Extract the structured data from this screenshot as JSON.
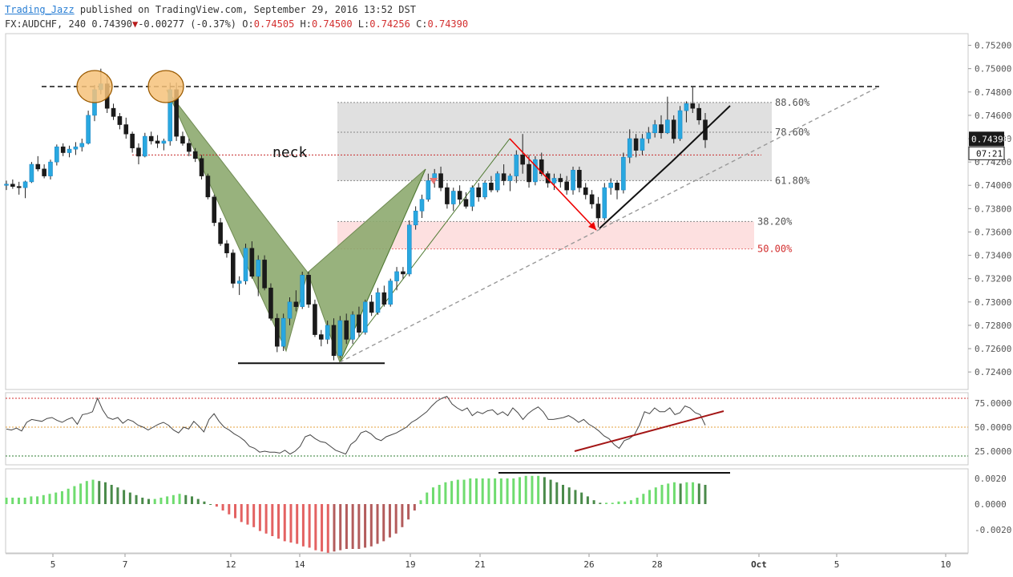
{
  "header": {
    "author": "Trading_Jazz",
    "published_text": " published on TradingView.com, September 29, 2016 13:52 DST",
    "symbol": "FX:AUDCHF, 240",
    "last": "0.74390",
    "change": "-0.00277 (-0.37%)",
    "open_label": "O:",
    "open": "0.74505",
    "high_label": "H:",
    "high": "0.74500",
    "low_label": "L:",
    "low": "0.74256",
    "close_label": "C:",
    "close": "0.74390"
  },
  "chart_data": {
    "type": "candlestick",
    "price_axis": {
      "ylim": [
        0.7225,
        0.753
      ],
      "ticks": [
        "0.75200",
        "0.75000",
        "0.74800",
        "0.74600",
        "0.74400",
        "0.74200",
        "0.74000",
        "0.73800",
        "0.73600",
        "0.73400",
        "0.73200",
        "0.73000",
        "0.72800",
        "0.72600",
        "0.72400"
      ]
    },
    "last_price_label": "0.74398",
    "countdown_label": "07:21",
    "x_ticks": [
      "5",
      "7",
      "12",
      "14",
      "19",
      "21",
      "26",
      "28",
      "Oct",
      "5",
      "10"
    ],
    "candles": [
      [
        0.74,
        0.7404,
        0.7396,
        0.7401
      ],
      [
        0.7401,
        0.7405,
        0.7397,
        0.7399
      ],
      [
        0.7399,
        0.7403,
        0.7392,
        0.7398
      ],
      [
        0.7398,
        0.7404,
        0.7389,
        0.7403
      ],
      [
        0.7403,
        0.742,
        0.7402,
        0.7418
      ],
      [
        0.7418,
        0.7425,
        0.7412,
        0.7414
      ],
      [
        0.7414,
        0.7418,
        0.7406,
        0.7408
      ],
      [
        0.7408,
        0.7422,
        0.7405,
        0.742
      ],
      [
        0.742,
        0.7435,
        0.7417,
        0.7433
      ],
      [
        0.7433,
        0.7436,
        0.7425,
        0.7428
      ],
      [
        0.7428,
        0.7434,
        0.7424,
        0.7431
      ],
      [
        0.7431,
        0.7437,
        0.7426,
        0.7433
      ],
      [
        0.7433,
        0.744,
        0.7429,
        0.7436
      ],
      [
        0.7436,
        0.7464,
        0.7435,
        0.746
      ],
      [
        0.746,
        0.7486,
        0.7455,
        0.7482
      ],
      [
        0.7482,
        0.75,
        0.7478,
        0.7487
      ],
      [
        0.7487,
        0.7495,
        0.7462,
        0.7466
      ],
      [
        0.7466,
        0.747,
        0.7456,
        0.7459
      ],
      [
        0.7459,
        0.7462,
        0.7448,
        0.7452
      ],
      [
        0.7452,
        0.7458,
        0.744,
        0.7444
      ],
      [
        0.7444,
        0.7446,
        0.7428,
        0.7432
      ],
      [
        0.7432,
        0.7436,
        0.7418,
        0.7425
      ],
      [
        0.7425,
        0.7445,
        0.7424,
        0.7442
      ],
      [
        0.7442,
        0.7446,
        0.7435,
        0.7438
      ],
      [
        0.7438,
        0.7443,
        0.7432,
        0.7436
      ],
      [
        0.7436,
        0.744,
        0.743,
        0.7438
      ],
      [
        0.7438,
        0.7488,
        0.7434,
        0.7482
      ],
      [
        0.7482,
        0.7488,
        0.7438,
        0.7442
      ],
      [
        0.7442,
        0.7446,
        0.7434,
        0.7436
      ],
      [
        0.7436,
        0.744,
        0.7425,
        0.7429
      ],
      [
        0.7429,
        0.7432,
        0.742,
        0.7423
      ],
      [
        0.7423,
        0.7426,
        0.7405,
        0.7408
      ],
      [
        0.7408,
        0.741,
        0.7388,
        0.739
      ],
      [
        0.739,
        0.7392,
        0.7365,
        0.7368
      ],
      [
        0.7368,
        0.7372,
        0.7348,
        0.735
      ],
      [
        0.735,
        0.7353,
        0.7338,
        0.7342
      ],
      [
        0.7342,
        0.7345,
        0.7312,
        0.7316
      ],
      [
        0.7316,
        0.7322,
        0.7306,
        0.7318
      ],
      [
        0.7318,
        0.735,
        0.7315,
        0.7346
      ],
      [
        0.7346,
        0.7352,
        0.732,
        0.7322
      ],
      [
        0.7322,
        0.734,
        0.7305,
        0.7336
      ],
      [
        0.7336,
        0.734,
        0.731,
        0.7312
      ],
      [
        0.7312,
        0.7316,
        0.7284,
        0.7286
      ],
      [
        0.7286,
        0.729,
        0.7257,
        0.7262
      ],
      [
        0.7262,
        0.729,
        0.7258,
        0.7286
      ],
      [
        0.7286,
        0.7304,
        0.728,
        0.73
      ],
      [
        0.73,
        0.731,
        0.7292,
        0.7296
      ],
      [
        0.7296,
        0.7326,
        0.7294,
        0.7323
      ],
      [
        0.7323,
        0.7326,
        0.7295,
        0.7298
      ],
      [
        0.7298,
        0.7302,
        0.727,
        0.7272
      ],
      [
        0.7272,
        0.7276,
        0.7262,
        0.7268
      ],
      [
        0.7268,
        0.7284,
        0.7264,
        0.728
      ],
      [
        0.728,
        0.7286,
        0.725,
        0.7254
      ],
      [
        0.7254,
        0.7288,
        0.7252,
        0.7284
      ],
      [
        0.7284,
        0.729,
        0.7264,
        0.7268
      ],
      [
        0.7268,
        0.7292,
        0.7264,
        0.7289
      ],
      [
        0.7289,
        0.7296,
        0.727,
        0.7274
      ],
      [
        0.7274,
        0.7302,
        0.7272,
        0.73
      ],
      [
        0.73,
        0.7306,
        0.7288,
        0.7291
      ],
      [
        0.7291,
        0.7312,
        0.7289,
        0.7308
      ],
      [
        0.7308,
        0.7314,
        0.7296,
        0.7298
      ],
      [
        0.7298,
        0.732,
        0.7296,
        0.7318
      ],
      [
        0.7318,
        0.733,
        0.731,
        0.7326
      ],
      [
        0.7326,
        0.733,
        0.732,
        0.7324
      ],
      [
        0.7324,
        0.737,
        0.7322,
        0.7366
      ],
      [
        0.7366,
        0.7382,
        0.7362,
        0.7378
      ],
      [
        0.7378,
        0.7392,
        0.7372,
        0.7388
      ],
      [
        0.7388,
        0.741,
        0.7386,
        0.7404
      ],
      [
        0.7404,
        0.7414,
        0.7398,
        0.741
      ],
      [
        0.741,
        0.7416,
        0.7395,
        0.7398
      ],
      [
        0.7398,
        0.7402,
        0.738,
        0.7384
      ],
      [
        0.7384,
        0.7398,
        0.7378,
        0.7395
      ],
      [
        0.7395,
        0.74,
        0.7384,
        0.7388
      ],
      [
        0.7388,
        0.7394,
        0.738,
        0.7382
      ],
      [
        0.7382,
        0.74,
        0.7378,
        0.7398
      ],
      [
        0.7398,
        0.7402,
        0.7386,
        0.739
      ],
      [
        0.739,
        0.7404,
        0.7388,
        0.7402
      ],
      [
        0.7402,
        0.7408,
        0.7394,
        0.7396
      ],
      [
        0.7396,
        0.7412,
        0.7394,
        0.741
      ],
      [
        0.741,
        0.7418,
        0.74,
        0.7404
      ],
      [
        0.7404,
        0.741,
        0.7395,
        0.7408
      ],
      [
        0.7408,
        0.743,
        0.7402,
        0.7426
      ],
      [
        0.7426,
        0.7444,
        0.741,
        0.7418
      ],
      [
        0.7418,
        0.7426,
        0.7398,
        0.7403
      ],
      [
        0.7403,
        0.7425,
        0.74,
        0.7422
      ],
      [
        0.7422,
        0.7428,
        0.7408,
        0.741
      ],
      [
        0.741,
        0.7412,
        0.7398,
        0.7402
      ],
      [
        0.7402,
        0.741,
        0.7396,
        0.7406
      ],
      [
        0.7406,
        0.741,
        0.7398,
        0.7403
      ],
      [
        0.7403,
        0.7408,
        0.7392,
        0.7396
      ],
      [
        0.7396,
        0.7416,
        0.7392,
        0.7413
      ],
      [
        0.7413,
        0.7416,
        0.7394,
        0.7398
      ],
      [
        0.7398,
        0.7402,
        0.7388,
        0.7392
      ],
      [
        0.7392,
        0.7396,
        0.738,
        0.7384
      ],
      [
        0.7384,
        0.739,
        0.7364,
        0.7372
      ],
      [
        0.7372,
        0.7402,
        0.737,
        0.7398
      ],
      [
        0.7398,
        0.7406,
        0.7392,
        0.7402
      ],
      [
        0.7402,
        0.7404,
        0.7388,
        0.7396
      ],
      [
        0.7396,
        0.7428,
        0.7393,
        0.7424
      ],
      [
        0.7424,
        0.7448,
        0.7419,
        0.744
      ],
      [
        0.744,
        0.7444,
        0.7424,
        0.743
      ],
      [
        0.743,
        0.7444,
        0.7426,
        0.744
      ],
      [
        0.744,
        0.745,
        0.7436,
        0.7445
      ],
      [
        0.7445,
        0.7456,
        0.7441,
        0.7452
      ],
      [
        0.7452,
        0.746,
        0.744,
        0.7445
      ],
      [
        0.7445,
        0.7476,
        0.7444,
        0.7456
      ],
      [
        0.7456,
        0.746,
        0.7436,
        0.744
      ],
      [
        0.744,
        0.7468,
        0.7438,
        0.7464
      ],
      [
        0.7464,
        0.7472,
        0.7454,
        0.747
      ],
      [
        0.747,
        0.7484,
        0.7462,
        0.7466
      ],
      [
        0.7466,
        0.747,
        0.7452,
        0.7456
      ],
      [
        0.7456,
        0.7462,
        0.7432,
        0.7439
      ]
    ],
    "fibonacci_levels": [
      {
        "label": "88.60%",
        "price": 0.7471,
        "color": "#555555"
      },
      {
        "label": "78.60%",
        "price": 0.74455,
        "color": "#555555"
      },
      {
        "label": "61.80%",
        "price": 0.7404,
        "color": "#555555"
      },
      {
        "label": "38.20%",
        "price": 0.7369,
        "color": "#555555"
      },
      {
        "label": "50.00%",
        "price": 0.73455,
        "color": "#d32f2f"
      }
    ],
    "annotations": {
      "neck_label": "neck"
    },
    "rsi_axis": {
      "ticks": [
        "75.0000",
        "50.0000",
        "25.0000"
      ],
      "levels": [
        80,
        50,
        20
      ]
    },
    "rsi_values": [
      48,
      47,
      49,
      46,
      55,
      58,
      57,
      56,
      59,
      60,
      57,
      55,
      58,
      60,
      53,
      63,
      64,
      66,
      80,
      68,
      60,
      58,
      60,
      54,
      58,
      56,
      52,
      50,
      47,
      50,
      53,
      55,
      52,
      47,
      44,
      50,
      48,
      56,
      51,
      45,
      58,
      64,
      56,
      50,
      47,
      43,
      40,
      36,
      30,
      28,
      24,
      25,
      24,
      24,
      23,
      26,
      22,
      25,
      30,
      40,
      42,
      38,
      35,
      34,
      30,
      26,
      24,
      22,
      32,
      36,
      44,
      46,
      43,
      38,
      36,
      40,
      42,
      44,
      47,
      50,
      55,
      58,
      62,
      66,
      72,
      77,
      80,
      82,
      74,
      70,
      67,
      70,
      62,
      66,
      64,
      67,
      68,
      63,
      66,
      62,
      70,
      65,
      58,
      64,
      68,
      71,
      66,
      58,
      58,
      59,
      60,
      62,
      59,
      55,
      58,
      53,
      50,
      46,
      41,
      38,
      32,
      28,
      36,
      38,
      42,
      52,
      66,
      64,
      70,
      66,
      66,
      70,
      63,
      65,
      72,
      70,
      65,
      63,
      52
    ],
    "osc_axis": {
      "ticks": [
        "0.0020",
        "0.0000",
        "-0.0020"
      ]
    },
    "osc_values": [
      0.0005,
      0.0005,
      0.0005,
      0.0005,
      0.0006,
      0.0006,
      0.0007,
      0.0008,
      0.0009,
      0.001,
      0.0012,
      0.0014,
      0.0016,
      0.0018,
      0.0019,
      0.0018,
      0.0017,
      0.0015,
      0.0013,
      0.0011,
      0.0009,
      0.0007,
      0.0005,
      0.0004,
      0.0004,
      0.0005,
      0.0006,
      0.0007,
      0.0008,
      0.0007,
      0.0006,
      0.0004,
      0.0002,
      0.0,
      -0.0002,
      -0.0005,
      -0.0008,
      -0.0011,
      -0.0014,
      -0.0016,
      -0.0018,
      -0.0021,
      -0.0023,
      -0.0025,
      -0.0027,
      -0.0029,
      -0.003,
      -0.0031,
      -0.0033,
      -0.0034,
      -0.0036,
      -0.0037,
      -0.0038,
      -0.0037,
      -0.0036,
      -0.0035,
      -0.0035,
      -0.0035,
      -0.0034,
      -0.0033,
      -0.0031,
      -0.0029,
      -0.0026,
      -0.0023,
      -0.0018,
      -0.0012,
      -0.0005,
      0.0003,
      0.0009,
      0.0013,
      0.0015,
      0.0017,
      0.0018,
      0.0019,
      0.0019,
      0.002,
      0.002,
      0.002,
      0.002,
      0.002,
      0.002,
      0.002,
      0.002,
      0.0021,
      0.0022,
      0.0022,
      0.0022,
      0.0021,
      0.0019,
      0.0017,
      0.0015,
      0.0013,
      0.0011,
      0.0009,
      0.0006,
      0.0003,
      0.0001,
      0.0001,
      0.0001,
      0.0002,
      0.0002,
      0.0003,
      0.0005,
      0.0008,
      0.0011,
      0.0013,
      0.0015,
      0.0016,
      0.0017,
      0.0016,
      0.0017,
      0.0017,
      0.0016,
      0.0015
    ]
  }
}
